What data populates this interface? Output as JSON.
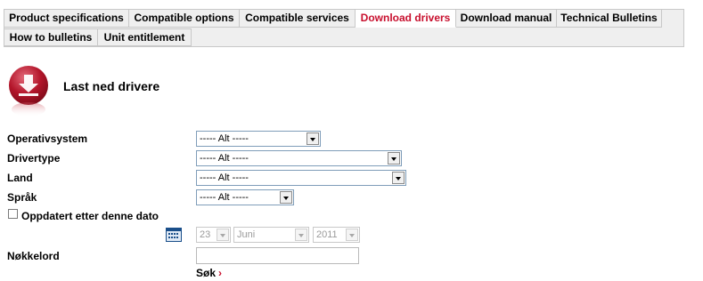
{
  "tabs": {
    "row1": [
      {
        "label": "Product specifications",
        "active": false
      },
      {
        "label": "Compatible options",
        "active": false
      },
      {
        "label": "Compatible services",
        "active": false
      },
      {
        "label": "Download drivers",
        "active": true
      },
      {
        "label": "Download manual",
        "active": false
      },
      {
        "label": "Technical Bulletins",
        "active": false
      }
    ],
    "row2": [
      {
        "label": "How to bulletins",
        "active": false
      },
      {
        "label": "Unit entitlement",
        "active": false
      }
    ]
  },
  "header": {
    "title": "Last ned drivere",
    "icon": "download-icon"
  },
  "form": {
    "os": {
      "label": "Operativsystem",
      "value": "----- Alt -----"
    },
    "drivertype": {
      "label": "Drivertype",
      "value": "----- Alt -----"
    },
    "country": {
      "label": "Land",
      "value": "----- Alt -----"
    },
    "language": {
      "label": "Språk",
      "value": "----- Alt -----"
    },
    "updated_after": {
      "label": "Oppdatert etter denne dato",
      "checked": false
    },
    "date": {
      "day": "23",
      "month": "Juni",
      "year": "2011",
      "icon": "calendar-icon"
    },
    "keyword": {
      "label": "Nøkkelord",
      "value": ""
    },
    "search_label": "Søk"
  },
  "colors": {
    "accent": "#c8102e",
    "tab_bg": "#efefef",
    "border": "#c8c8c8"
  }
}
